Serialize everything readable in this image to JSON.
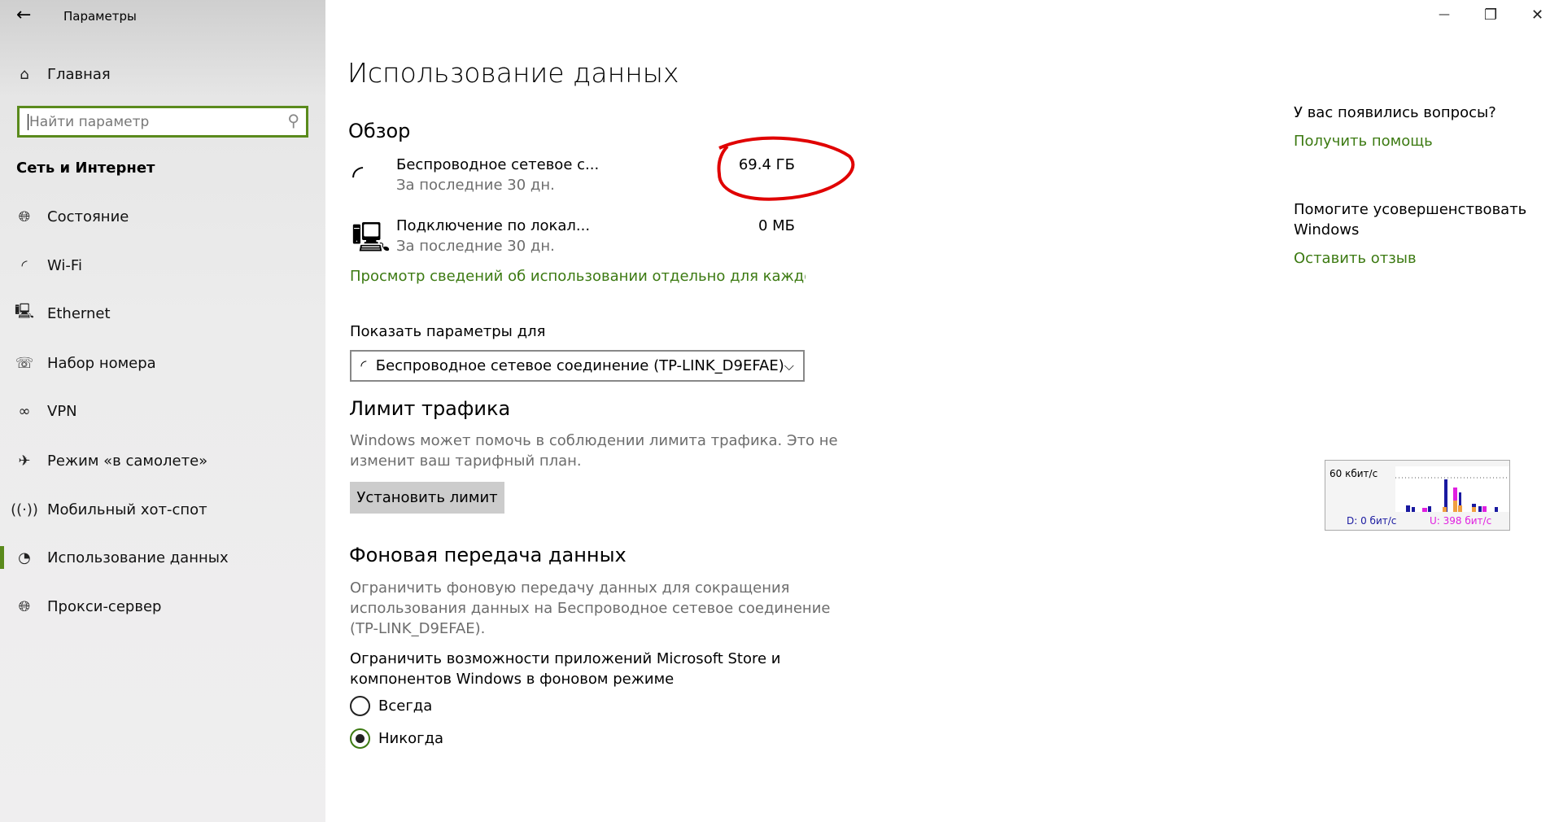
{
  "window": {
    "title": "Параметры",
    "back_icon": "arrow-left",
    "controls": {
      "minimize": "—",
      "maximize": "❐",
      "close": "✕"
    }
  },
  "sidebar": {
    "home": "Главная",
    "search_placeholder": "Найти параметр",
    "section": "Сеть и Интернет",
    "items": [
      {
        "label": "Состояние",
        "icon": "globe"
      },
      {
        "label": "Wi-Fi",
        "icon": "wifi"
      },
      {
        "label": "Ethernet",
        "icon": "ethernet"
      },
      {
        "label": "Набор номера",
        "icon": "dialup"
      },
      {
        "label": "VPN",
        "icon": "vpn"
      },
      {
        "label": "Режим «в самолете»",
        "icon": "airplane"
      },
      {
        "label": "Мобильный хот-спот",
        "icon": "hotspot"
      },
      {
        "label": "Использование данных",
        "icon": "data-usage",
        "selected": true
      },
      {
        "label": "Прокси-сервер",
        "icon": "globe"
      }
    ]
  },
  "main": {
    "title": "Использование данных",
    "overview": {
      "heading": "Обзор",
      "connections": [
        {
          "name": "Беспроводное сетевое с...",
          "period": "За последние 30 дн.",
          "value": "69.4 ГБ",
          "icon": "wifi"
        },
        {
          "name": "Подключение по локал...",
          "period": "За последние 30 дн.",
          "value": "0 МБ",
          "icon": "ethernet"
        }
      ],
      "details_link": "Просмотр сведений об использовании отдельно для каждого пр"
    },
    "show_for_label": "Показать параметры для",
    "show_for_value": "Беспроводное сетевое соединение (TP-LINK_D9EFAE)",
    "limit": {
      "heading": "Лимит трафика",
      "desc": [
        "Windows может помочь в соблюдении лимита трафика. Это не",
        "изменит ваш тарифный план."
      ],
      "button": "Установить лимит"
    },
    "background": {
      "heading": "Фоновая передача данных",
      "desc": [
        "Ограничить фоновую передачу данных для сокращения",
        "использования данных на Беспроводное сетевое соединение",
        "(TP-LINK_D9EFAE)."
      ],
      "question": [
        "Ограничить возможности приложений Microsoft Store и",
        "компонентов Windows в фоновом режиме"
      ],
      "options": [
        {
          "label": "Всегда",
          "selected": false
        },
        {
          "label": "Никогда",
          "selected": true
        }
      ]
    }
  },
  "right": {
    "q": "У вас появились вопросы?",
    "help": "Получить помощь",
    "improve": [
      "Помогите усовершенствовать",
      "Windows"
    ],
    "feedback": "Оставить отзыв"
  },
  "meter": {
    "scale": "60 кбит/с",
    "down": "D: 0 бит/с",
    "up": "U: 398 бит/с"
  },
  "colors": {
    "accent": "#3c7a12",
    "annotation": "#e00000",
    "download": "#1a1aa0",
    "upload": "#e020e0"
  }
}
